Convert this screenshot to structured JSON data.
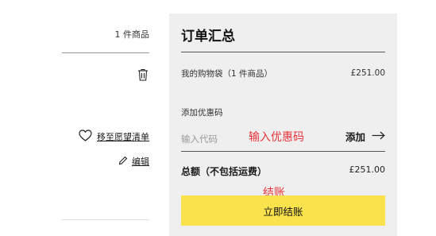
{
  "cart_item": {
    "count_label": "1 件商品",
    "wishlist_label": "移至愿望清单",
    "edit_label": "编辑"
  },
  "summary": {
    "title": "订单汇总",
    "bag_label": "我的购物袋（1 件商品）",
    "bag_price": "£251.00",
    "promo_title": "添加优惠码",
    "promo_placeholder": "输入代码",
    "promo_annotation": "输入优惠码",
    "promo_add_label": "添加",
    "total_label": "总额（不包括运费）",
    "total_value": "£251.00",
    "checkout_annotation": "结账",
    "checkout_label": "立即结账"
  },
  "colors": {
    "checkout_button": "#f9e24b",
    "annotation": "#e8343a",
    "panel_background": "#efefef"
  }
}
